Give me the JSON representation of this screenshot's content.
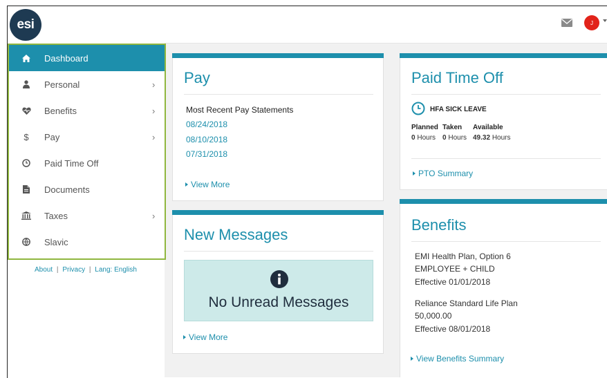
{
  "header": {
    "logo_text": "esi",
    "avatar_initial": "J",
    "icons": {
      "mail": "mail-icon",
      "chevron": "chevron-down-icon"
    }
  },
  "sidebar": {
    "items": [
      {
        "label": "Dashboard",
        "icon": "home-icon",
        "active": true,
        "has_submenu": false
      },
      {
        "label": "Personal",
        "icon": "user-icon",
        "active": false,
        "has_submenu": true
      },
      {
        "label": "Benefits",
        "icon": "heart-icon",
        "active": false,
        "has_submenu": true
      },
      {
        "label": "Pay",
        "icon": "dollar-icon",
        "active": false,
        "has_submenu": true
      },
      {
        "label": "Paid Time Off",
        "icon": "clock-icon",
        "active": false,
        "has_submenu": false
      },
      {
        "label": "Documents",
        "icon": "document-icon",
        "active": false,
        "has_submenu": false
      },
      {
        "label": "Taxes",
        "icon": "bank-icon",
        "active": false,
        "has_submenu": true
      },
      {
        "label": "Slavic",
        "icon": "globe-icon",
        "active": false,
        "has_submenu": false
      }
    ],
    "chevron_glyph": "›"
  },
  "footer": {
    "about": "About",
    "privacy": "Privacy",
    "lang": "Lang: English",
    "sep": "|"
  },
  "pay": {
    "title": "Pay",
    "subtitle": "Most Recent Pay Statements",
    "statements": [
      "08/24/2018",
      "08/10/2018",
      "07/31/2018"
    ],
    "view_more": "View More"
  },
  "messages": {
    "title": "New Messages",
    "empty_text": "No Unread Messages",
    "view_more": "View More"
  },
  "pto": {
    "title": "Paid Time Off",
    "plan_name": "HFA SICK LEAVE",
    "col_planned": "Planned",
    "col_taken": "Taken",
    "col_available": "Available",
    "planned_value": "0",
    "taken_value": "0",
    "available_value": "49.32",
    "hours_unit": "Hours",
    "summary_link": "PTO Summary"
  },
  "benefits": {
    "title": "Benefits",
    "plans": [
      {
        "line1": "EMI Health Plan, Option 6",
        "line2": "EMPLOYEE + CHILD",
        "line3": "Effective 01/01/2018"
      },
      {
        "line1": "Reliance Standard Life Plan",
        "line2": "50,000.00",
        "line3": "Effective 08/01/2018"
      }
    ],
    "summary_link": "View Benefits Summary"
  },
  "colors": {
    "accent": "#1d8fac",
    "sidebar_outline": "#8fb63e",
    "logo_bg": "#1e3a52",
    "avatar_bg": "#e2231a",
    "empty_message_bg": "#cdeae9"
  }
}
